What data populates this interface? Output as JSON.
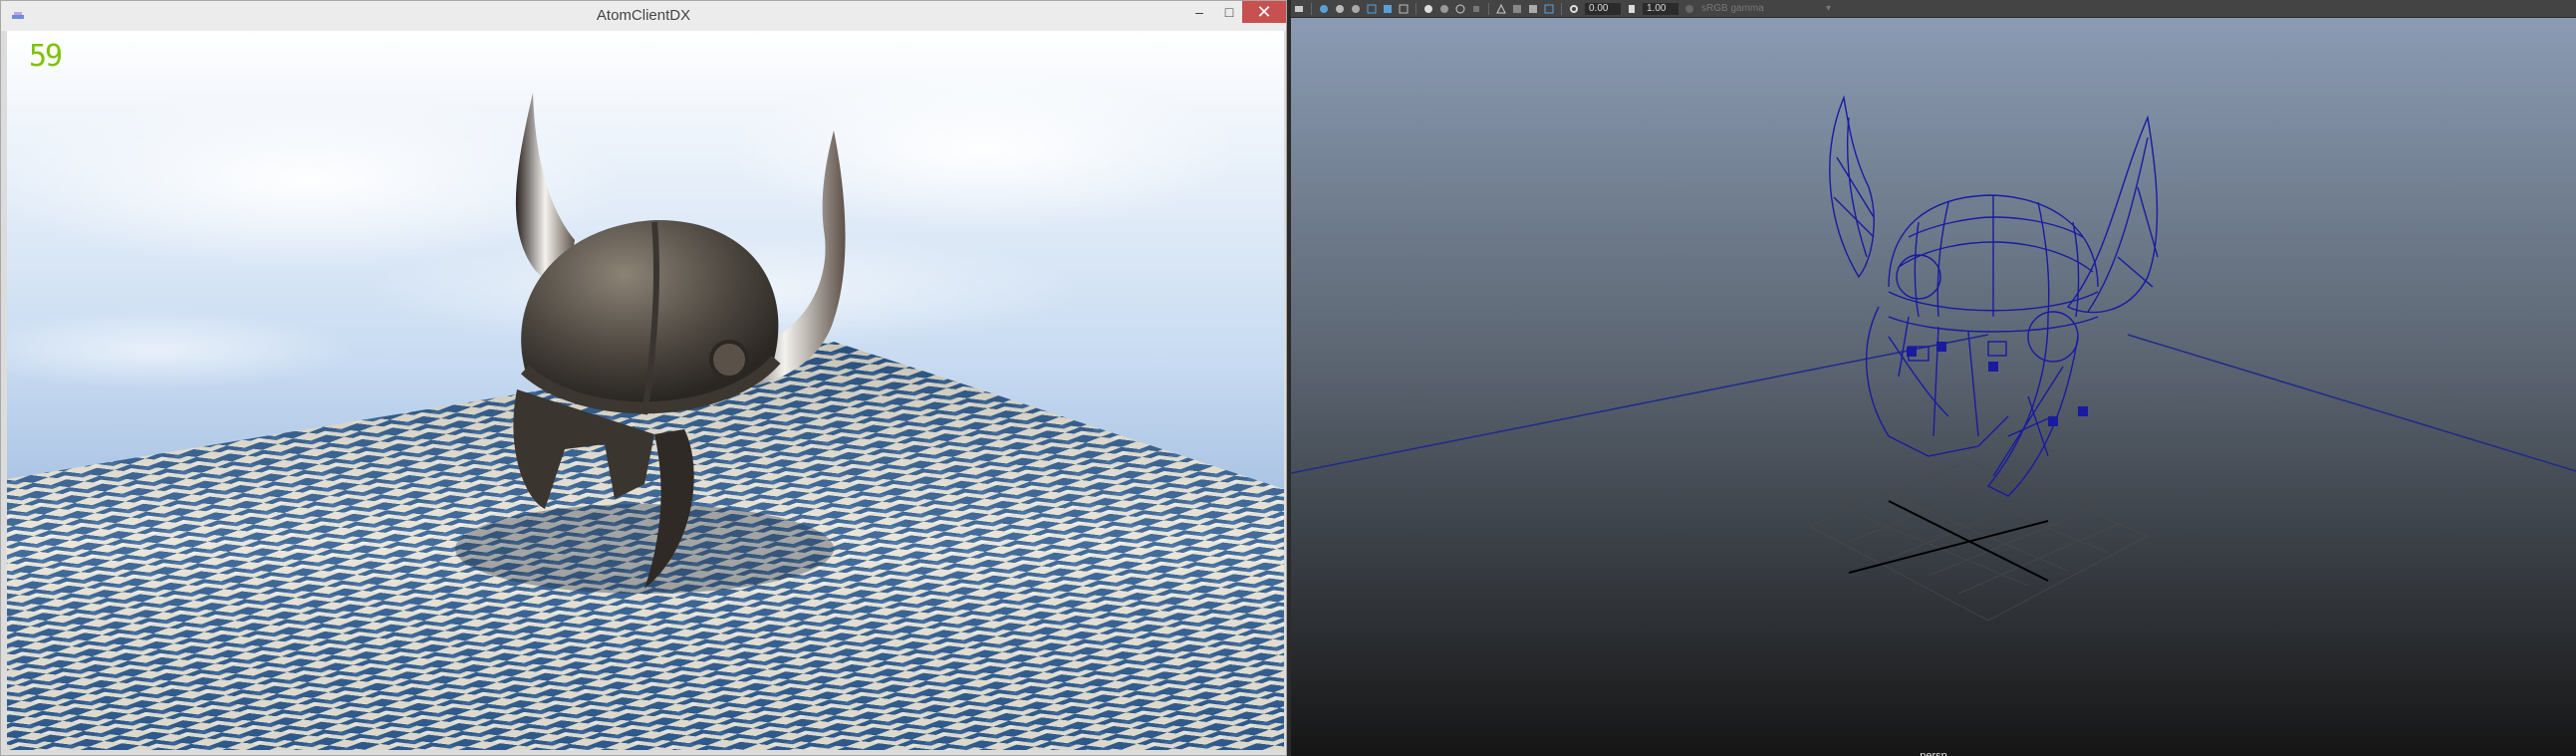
{
  "left_window": {
    "title": "AtomClientDX",
    "fps": "59",
    "controls": {
      "minimize": "–",
      "maximize": "□",
      "close": "✕"
    }
  },
  "right_window": {
    "toolbar": {
      "exposure_value": "0.00",
      "gamma_value": "1.00",
      "color_space": "sRGB gamma",
      "icons": [
        "select-camera-icon",
        "camera-attributes-icon",
        "bookmark-icon",
        "image-plane-icon",
        "grid-icon",
        "film-gate-icon",
        "resolution-gate-icon",
        "gate-mask-icon",
        "field-chart-icon",
        "safe-action-icon",
        "safe-title-icon",
        "wireframe-icon",
        "smooth-shade-icon",
        "textured-icon",
        "lights-icon",
        "shadows-icon",
        "xray-icon",
        "isolate-select-icon",
        "exposure-icon",
        "gamma-icon",
        "view-transform-icon"
      ]
    },
    "camera_label": "persp"
  },
  "colors": {
    "fps_green": "#7dc300",
    "wireframe_blue": "#1a1aa0",
    "close_red": "#c75050",
    "maya_bg_top": "#8a9bb3",
    "maya_bg_bottom": "#151515"
  }
}
